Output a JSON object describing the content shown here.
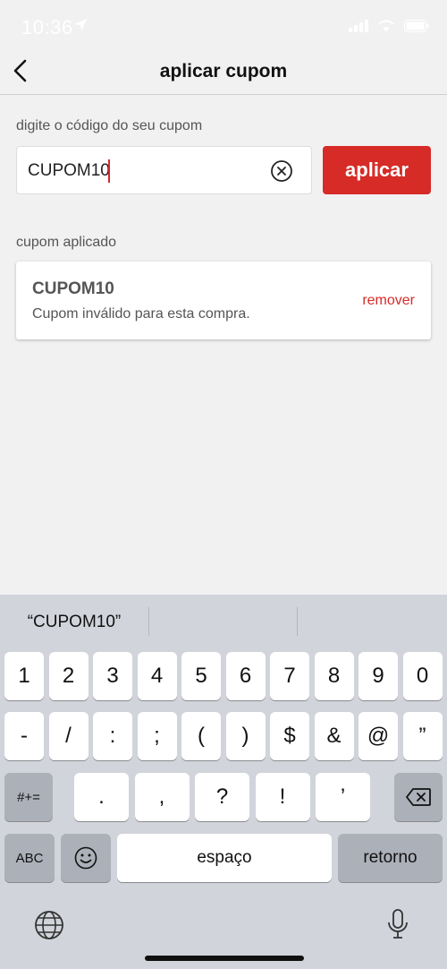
{
  "status_bar": {
    "time": "10:36"
  },
  "header": {
    "title": "aplicar cupom"
  },
  "coupon_form": {
    "label": "digite o código do seu cupom",
    "input_value": "CUPOM10",
    "apply_label": "aplicar"
  },
  "applied": {
    "label": "cupom aplicado",
    "code": "CUPOM10",
    "message": "Cupom inválido para esta compra.",
    "remove_label": "remover"
  },
  "keyboard": {
    "suggestion": "“CUPOM10”",
    "row1": [
      "1",
      "2",
      "3",
      "4",
      "5",
      "6",
      "7",
      "8",
      "9",
      "0"
    ],
    "row2": [
      "-",
      "/",
      ":",
      ";",
      "(",
      ")",
      "$",
      "&",
      "@",
      "”"
    ],
    "row3": [
      ".",
      ",",
      "?",
      "!",
      "’"
    ],
    "symbols_label": "#+=",
    "abc_label": "ABC",
    "space_label": "espaço",
    "return_label": "retorno"
  },
  "colors": {
    "accent": "#d62b27",
    "background": "#f1f1f2"
  }
}
